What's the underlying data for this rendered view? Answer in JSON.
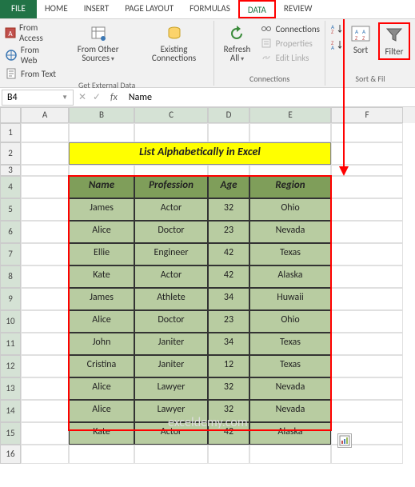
{
  "tabs": {
    "file": "FILE",
    "home": "HOME",
    "insert": "INSERT",
    "page_layout": "PAGE LAYOUT",
    "formulas": "FORMULAS",
    "data": "DATA",
    "review": "REVIEW"
  },
  "ribbon": {
    "get_external": {
      "from_access": "From Access",
      "from_web": "From Web",
      "from_text": "From Text",
      "other_sources": "From Other Sources",
      "existing_connections": "Existing Connections",
      "group_label": "Get External Data"
    },
    "connections": {
      "refresh_all": "Refresh All",
      "connections": "Connections",
      "properties": "Properties",
      "edit_links": "Edit Links",
      "group_label": "Connections"
    },
    "sort_filter": {
      "sort_asc": "A→Z",
      "sort_desc": "Z→A",
      "sort": "Sort",
      "filter": "Filter",
      "group_label": "Sort & Fil"
    }
  },
  "namebox": "B4",
  "formula_value": "Name",
  "columns": [
    "A",
    "B",
    "C",
    "D",
    "E",
    "F"
  ],
  "title": "List Alphabetically in Excel",
  "headers": {
    "name": "Name",
    "profession": "Profession",
    "age": "Age",
    "region": "Region"
  },
  "chart_data": {
    "type": "table",
    "columns": [
      "Name",
      "Profession",
      "Age",
      "Region"
    ],
    "rows": [
      [
        "James",
        "Actor",
        32,
        "Ohio"
      ],
      [
        "Alice",
        "Doctor",
        23,
        "Nevada"
      ],
      [
        "Ellie",
        "Engineer",
        42,
        "Texas"
      ],
      [
        "Kate",
        "Actor",
        42,
        "Alaska"
      ],
      [
        "James",
        "Athlete",
        34,
        "Huwaii"
      ],
      [
        "Alice",
        "Doctor",
        23,
        "Ohio"
      ],
      [
        "John",
        "Janiter",
        34,
        "Texas"
      ],
      [
        "Cristina",
        "Janiter",
        12,
        "Texas"
      ],
      [
        "Alice",
        "Lawyer",
        32,
        "Nevada"
      ],
      [
        "Alice",
        "Lawyer",
        32,
        "Nevada"
      ],
      [
        "Kate",
        "Actor",
        42,
        "Alaska"
      ]
    ]
  },
  "watermark": "exceldemy.com"
}
